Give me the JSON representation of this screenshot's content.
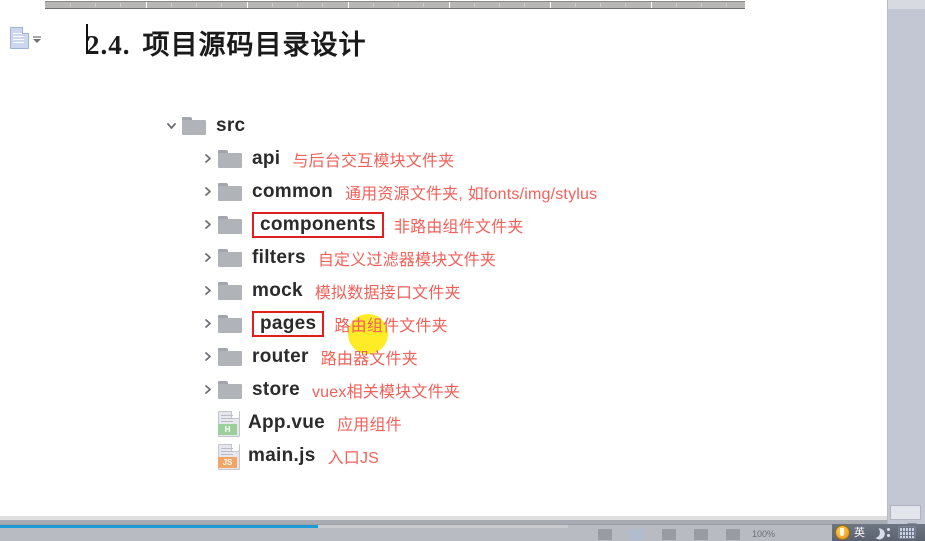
{
  "document": {
    "heading_number": "2.4.",
    "heading_text": "项目源码目录设计"
  },
  "paste_tag": {
    "name": "paste-options",
    "icon": "paste-icon"
  },
  "tree": {
    "root": {
      "name": "src",
      "expanded": true,
      "chevron": "chevron-down-icon",
      "icon": "folder-icon",
      "annotation": ""
    },
    "children": [
      {
        "name": "api",
        "chevron": "chevron-right-icon",
        "icon": "folder-icon",
        "annotation": "与后台交互模块文件夹",
        "boxed": false,
        "type": "folder"
      },
      {
        "name": "common",
        "chevron": "chevron-right-icon",
        "icon": "folder-icon",
        "annotation": "通用资源文件夹, 如fonts/img/stylus",
        "boxed": false,
        "type": "folder"
      },
      {
        "name": "components",
        "chevron": "chevron-right-icon",
        "icon": "folder-icon",
        "annotation": "非路由组件文件夹",
        "boxed": true,
        "type": "folder"
      },
      {
        "name": "filters",
        "chevron": "chevron-right-icon",
        "icon": "folder-icon",
        "annotation": "自定义过滤器模块文件夹",
        "boxed": false,
        "type": "folder"
      },
      {
        "name": "mock",
        "chevron": "chevron-right-icon",
        "icon": "folder-icon",
        "annotation": "模拟数据接口文件夹",
        "boxed": false,
        "type": "folder"
      },
      {
        "name": "pages",
        "chevron": "chevron-right-icon",
        "icon": "folder-icon",
        "annotation": "路由组件文件夹",
        "boxed": true,
        "type": "folder"
      },
      {
        "name": "router",
        "chevron": "chevron-right-icon",
        "icon": "folder-icon",
        "annotation": "路由器文件夹",
        "boxed": false,
        "type": "folder"
      },
      {
        "name": "store",
        "chevron": "chevron-right-icon",
        "icon": "folder-icon",
        "annotation": "vuex相关模块文件夹",
        "boxed": false,
        "type": "folder"
      },
      {
        "name": "App.vue",
        "chevron": "",
        "icon": "vue-file-icon",
        "badge": "H",
        "annotation": "应用组件",
        "boxed": false,
        "type": "file"
      },
      {
        "name": "main.js",
        "chevron": "",
        "icon": "js-file-icon",
        "badge": "JS",
        "annotation": "入口JS",
        "boxed": false,
        "type": "file"
      }
    ]
  },
  "cursor_highlight": {
    "name": "cursor-spotlight",
    "color": "#ffe800"
  },
  "status_bar": {
    "zoom_level": "100%",
    "progress_color": "#1e9ad6"
  },
  "ime_bar": {
    "mode_label": "英",
    "icons": [
      "sogou-logo-icon",
      "moon-icon",
      "dots-icon",
      "keyboard-icon"
    ]
  },
  "colors": {
    "annotation_red": "#f2605a",
    "box_red": "#e02020",
    "folder_gray": "#b0b3b8",
    "heading_black": "#1a1a1a"
  }
}
